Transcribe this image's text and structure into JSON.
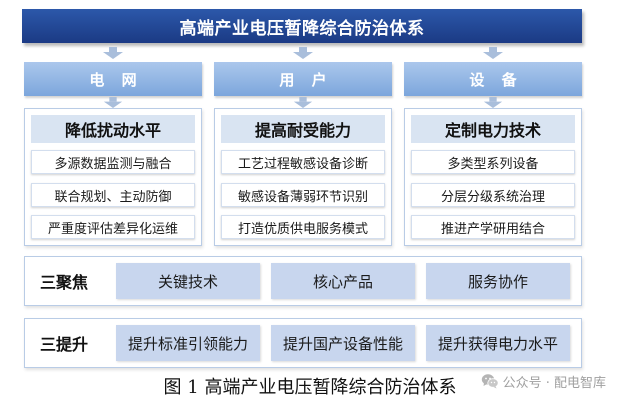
{
  "title": "高端产业电压暂降综合防治体系",
  "columns": [
    {
      "header": "电 网",
      "title": "降低扰动水平",
      "items": [
        "多源数据监测与融合",
        "联合规划、主动防御",
        "严重度评估差异化运维"
      ]
    },
    {
      "header": "用 户",
      "title": "提高耐受能力",
      "items": [
        "工艺过程敏感设备诊断",
        "敏感设备薄弱环节识别",
        "打造优质供电服务模式"
      ]
    },
    {
      "header": "设 备",
      "title": "定制电力技术",
      "items": [
        "多类型系列设备",
        "分层分级系统治理",
        "推进产学研用结合"
      ]
    }
  ],
  "rows": [
    {
      "label": "三聚焦",
      "items": [
        "关键技术",
        "核心产品",
        "服务协作"
      ]
    },
    {
      "label": "三提升",
      "items": [
        "提升标准引领能力",
        "提升国产设备性能",
        "提升获得电力水平"
      ]
    }
  ],
  "caption": "图 1 高端产业电压暂降综合防治体系",
  "watermark": {
    "icon": "wechat-icon",
    "text": "公众号 · 配电智库"
  },
  "colors": {
    "title_bar_top": "#2c58aa",
    "title_bar_bottom": "#1b3a84",
    "header_top": "#abc7ec",
    "header_bottom": "#7ca6dc",
    "title_box": "#d9e4f2",
    "row_cell": "#c8d6ee",
    "arrow": "#a9bedb"
  }
}
